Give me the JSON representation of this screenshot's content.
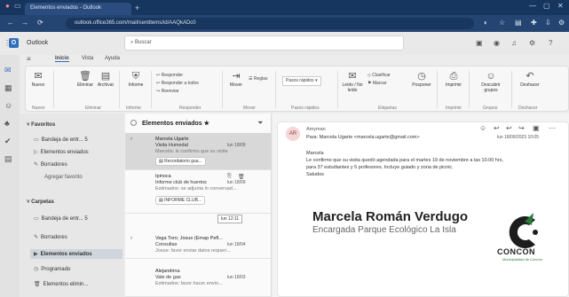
{
  "browser": {
    "tab_title": "Elementos enviados - Outlook",
    "url": "outlook.office365.com/mail/sentitems/id/AAQkADc0",
    "nav": {
      "back": "←",
      "forward": "→",
      "reload": "⟳"
    }
  },
  "app": {
    "title": "Outlook",
    "search_placeholder": "Buscar"
  },
  "ribbon": {
    "tabs": [
      "Inicio",
      "Vista",
      "Ayuda"
    ],
    "buttons": {
      "new": "Nuevo",
      "delete": "Eliminar",
      "archive": "Archivar",
      "report": "Informe",
      "reply": "Responder",
      "reply_all": "Responder a todos",
      "forward": "Reenviar",
      "move": "Mover",
      "rules": "Reglas",
      "quick_steps": "Pasos rápidos",
      "read_unread": "Leído / No leído",
      "flag": "Marcar",
      "categorize": "Clasificar",
      "snooze": "Posponer",
      "print": "Imprimir",
      "discover_groups": "Descubrir grupos",
      "undo": "Deshacer"
    },
    "groups": [
      "Nuevo",
      "Eliminar",
      "Informe",
      "Responder",
      "Mover",
      "Pasos rápidos",
      "Etiquetas",
      "Imprimir",
      "Grupos",
      "Deshacer"
    ]
  },
  "folders": {
    "favorites_title": "Favoritos",
    "favorites": [
      {
        "label": "Bandeja de entr...",
        "count": "5"
      },
      {
        "label": "Elementos enviados",
        "count": ""
      },
      {
        "label": "Borradores",
        "count": ""
      },
      {
        "label": "Agregar favorito",
        "count": ""
      }
    ],
    "folders_title": "Carpetas",
    "folders": [
      {
        "label": "Bandeja de entr...",
        "count": "5"
      },
      {
        "label": "Borradores",
        "count": ""
      },
      {
        "label": "Elementos enviados",
        "count": ""
      },
      {
        "label": "Programado",
        "count": ""
      },
      {
        "label": "Elementos elimin...",
        "count": ""
      }
    ]
  },
  "list": {
    "header": "Elementos enviados",
    "messages": [
      {
        "name": "Marcela Ugarte",
        "subject": "Visita Humedal",
        "time": "lun 18/09",
        "preview": "Marcela: le confirmo que su visita",
        "chip": "Recordatorio gua..."
      },
      {
        "name": "Ipinoca",
        "subject": "Informe club de huertos",
        "time": "lun 18/09",
        "preview": "Estimados: se adjunta lo conversad...",
        "chip": "INFORME CLUB..."
      },
      {
        "name": "Vega Toro; Josue (Emap Pefl...",
        "subject": "Consultas",
        "time": "lun 18/04",
        "preview": "Josue: favor enviar datos requeri...",
        "chip": ""
      },
      {
        "name": "Alejandrina",
        "subject": "Vale de gas",
        "time": "lun 18/03",
        "preview": "Estimados: favor hacer envío...",
        "chip": ""
      }
    ],
    "tooltip": "lun 12:11"
  },
  "reading": {
    "sender": "Amyman",
    "avatar_initials": "AR",
    "to_line": "Para: Marcela Ugarte <marcela.ugarte@gmail.com>",
    "date": "lun 18/09/2023 10:05",
    "greeting": "Marcela",
    "body_line1": "Le confirmo que su visita quedó agendada para el martes 19 de noviembre a las 10.00 hrs,",
    "body_line2": "para 37 estudiantes y 5 profesores. Incluye guiado y zona de picnic.",
    "closing": "Saludos",
    "signature_name": "Marcela Román Verdugo",
    "signature_title": "Encargada Parque Ecológico La Isla",
    "logo_text": "CONCÓN",
    "logo_subtitle": "Municipalidad de Concón"
  },
  "colors": {
    "browser_dark": "#16355f",
    "accent": "#2f6fbd",
    "logo_black": "#1d1d1d",
    "logo_green": "#2a7a3a"
  }
}
